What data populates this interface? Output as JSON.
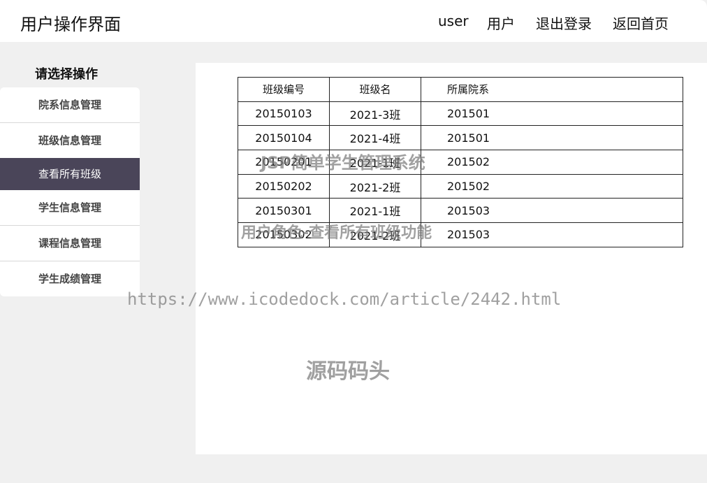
{
  "header": {
    "title": "用户操作界面",
    "nav": {
      "username": "user",
      "profile": "用户",
      "logout": "退出登录",
      "home": "返回首页"
    }
  },
  "sidebar": {
    "title": "请选择操作",
    "items": [
      {
        "label": "院系信息管理",
        "active": false
      },
      {
        "label": "班级信息管理",
        "active": false
      },
      {
        "label": "查看所有班级",
        "active": true
      },
      {
        "label": "学生信息管理",
        "active": false
      },
      {
        "label": "课程信息管理",
        "active": false
      },
      {
        "label": "学生成绩管理",
        "active": false
      }
    ]
  },
  "table": {
    "columns": [
      "班级编号",
      "班级名",
      "所属院系"
    ],
    "rows": [
      [
        "20150103",
        "2021-3班",
        "201501"
      ],
      [
        "20150104",
        "2021-4班",
        "201501"
      ],
      [
        "20150201",
        "2021-1班",
        "201502"
      ],
      [
        "20150202",
        "2021-2班",
        "201502"
      ],
      [
        "20150301",
        "2021-1班",
        "201503"
      ],
      [
        "20150302",
        "2021-2班",
        "201503"
      ]
    ]
  },
  "watermarks": {
    "line1": "JSP简单学生管理系统",
    "line2": "用户角色-查看所有班级功能",
    "url": "https://www.icodedock.com/article/2442.html",
    "brand": "源码码头"
  },
  "colors": {
    "active_bg": "#4a4559",
    "page_bg": "#f0f0f0"
  }
}
